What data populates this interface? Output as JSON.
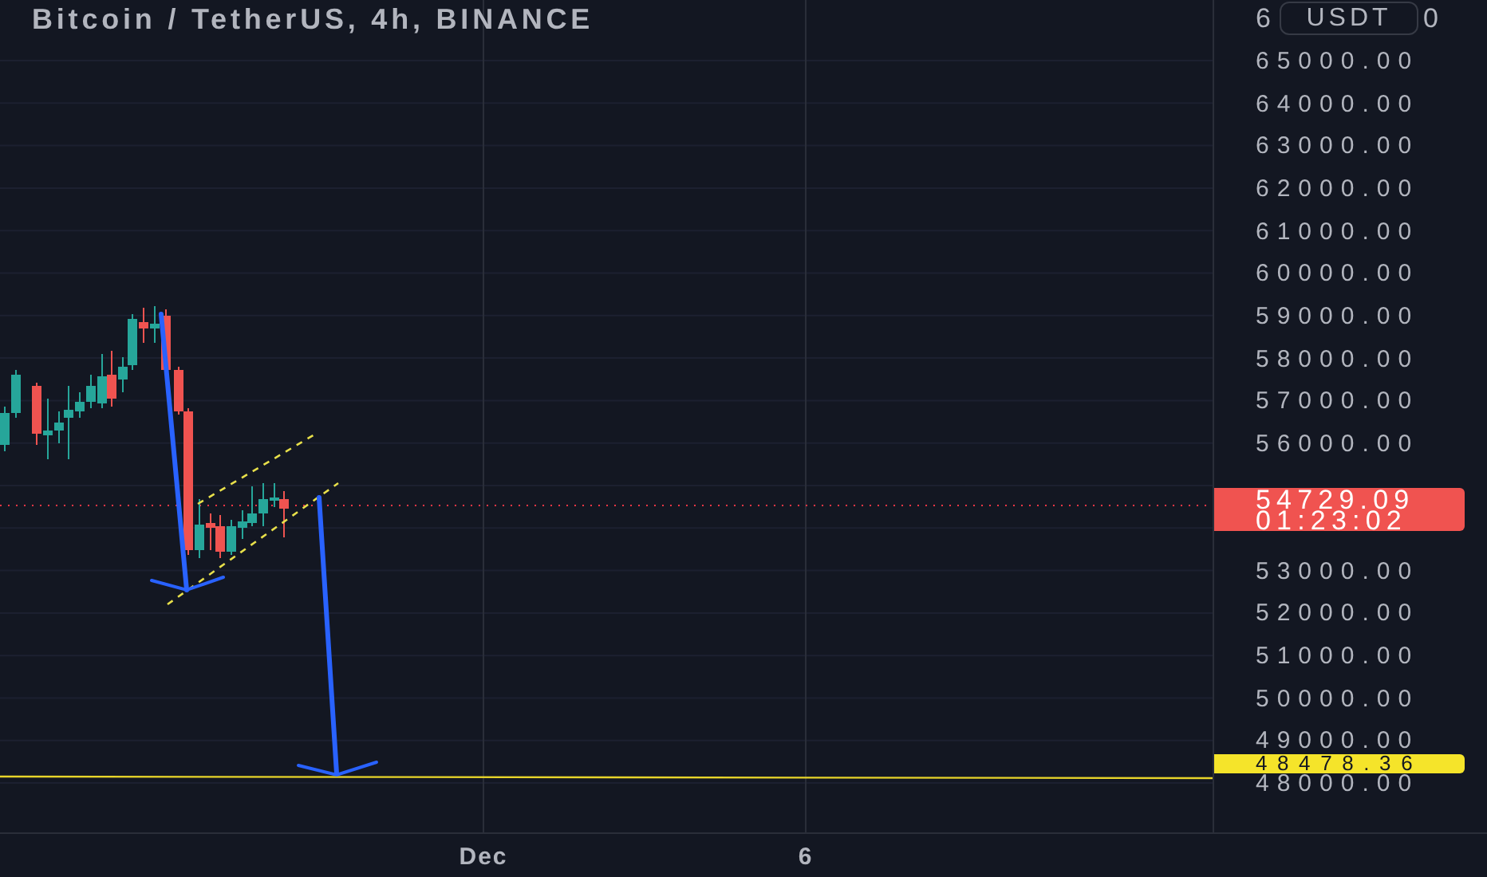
{
  "header": {
    "title": "Bitcoin / TetherUS, 4h, BINANCE"
  },
  "price_axis": {
    "currency": "USDT",
    "top_left_fragment": "6",
    "top_right_fragment": "0",
    "ticks": [
      "65000.00",
      "64000.00",
      "63000.00",
      "62000.00",
      "61000.00",
      "60000.00",
      "59000.00",
      "58000.00",
      "57000.00",
      "56000.00",
      "53000.00",
      "52000.00",
      "51000.00",
      "50000.00",
      "49000.00",
      "48000.00"
    ]
  },
  "last_price": {
    "price": "54729.09",
    "countdown": "01:23:02"
  },
  "target_line": {
    "price": "48478.36"
  },
  "time_axis": {
    "labels": [
      "Dec",
      "6"
    ]
  }
}
